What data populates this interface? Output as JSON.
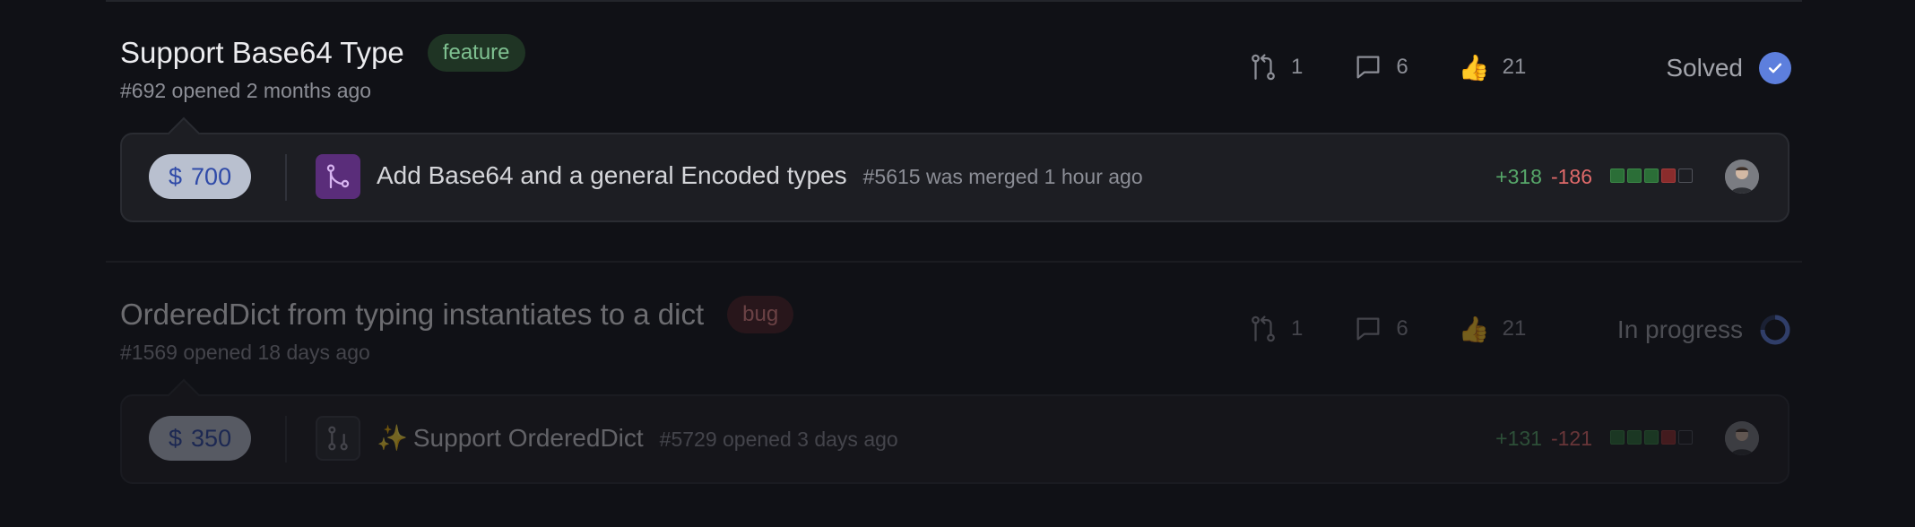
{
  "issues": [
    {
      "title": "Support Base64 Type",
      "label": "feature",
      "subtitle": "#692 opened 2 months ago",
      "pr_count": "1",
      "comment_count": "6",
      "thumbs_emoji": "👍",
      "thumbs_count": "21",
      "status": "Solved",
      "bounty": "700",
      "bounty_currency": "$",
      "pr_title": "Add Base64 and a general Encoded types",
      "pr_sub": "#5615 was merged 1 hour ago",
      "additions": "+318",
      "deletions": "-186"
    },
    {
      "title": "OrderedDict from typing instantiates to a dict",
      "label": "bug",
      "subtitle": "#1569 opened 18 days ago",
      "pr_count": "1",
      "comment_count": "6",
      "thumbs_emoji": "👍",
      "thumbs_count": "21",
      "status": "In progress",
      "bounty": "350",
      "bounty_currency": "$",
      "pr_sparkle": "✨",
      "pr_title": "Support OrderedDict",
      "pr_sub": "#5729 opened 3 days ago",
      "additions": "+131",
      "deletions": "-121"
    }
  ],
  "icons": {
    "pull_request": "pull-request-icon",
    "comment": "comment-icon",
    "thumbs_up": "thumbs-up-icon",
    "solved": "check-circle-icon",
    "in_progress": "progress-ring-icon",
    "merged": "merged-icon"
  },
  "colors": {
    "background": "#101116",
    "card": "#1d1e23",
    "feature_label_bg": "#1f3424",
    "feature_label_fg": "#7fc191",
    "bug_label_bg": "#4a2124",
    "bug_label_fg": "#e88787",
    "solved_badge": "#5d7fdd",
    "merged_badge": "#5a2d7a",
    "bounty_pill": "#b9c0cf",
    "bounty_text": "#2f4aa8",
    "additions": "#57a86a",
    "deletions": "#e06a6a"
  }
}
